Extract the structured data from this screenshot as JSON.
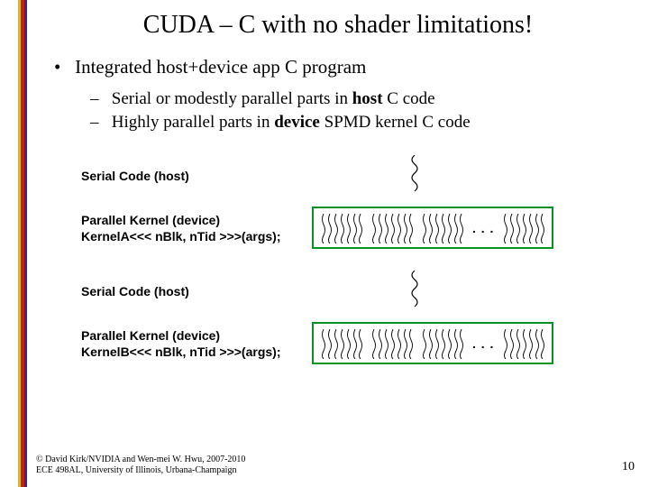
{
  "title": "CUDA – C with no shader limitations!",
  "bullets": {
    "main": "Integrated host+device app C program",
    "sub1_pre": "Serial or modestly parallel parts in ",
    "sub1_bold": "host",
    "sub1_post": " C code",
    "sub2_pre": "Highly parallel parts in ",
    "sub2_bold": "device",
    "sub2_post": " SPMD kernel C code"
  },
  "diagram": {
    "serial_label": "Serial Code (host)",
    "parallel_label": "Parallel Kernel (device)",
    "kernelA_call": "KernelA<<< nBlk, nTid >>>(args);",
    "kernelB_call": "KernelB<<< nBlk, nTid >>>(args);",
    "dots": ". . ."
  },
  "footer": {
    "line1": "© David Kirk/NVIDIA and Wen-mei W. Hwu, 2007-2010",
    "line2": "ECE 498AL, University of Illinois, Urbana-Champaign"
  },
  "page_number": "10"
}
